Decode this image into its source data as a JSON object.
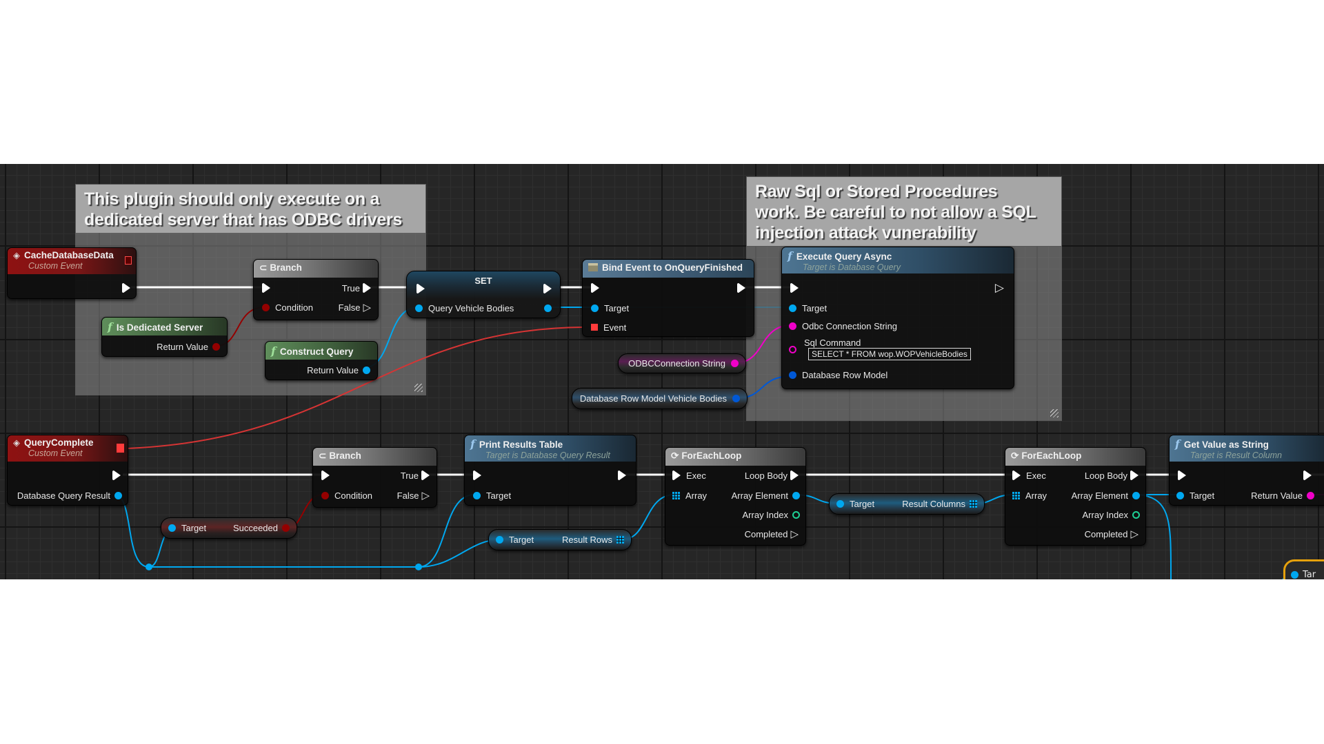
{
  "canvas": {
    "type": "blueprint-graph"
  },
  "colors": {
    "exec": "#ffffff",
    "object_pin": "#00a8f0",
    "string_pin": "#f000c8",
    "bool_pin": "#940000",
    "int_pin": "#1ed195",
    "struct_pin": "#0058d6",
    "delegate_pin": "#ff3b3b",
    "event_header": "#8e1212",
    "function_header": "#4e7592",
    "pure_header": "#5f8e5b"
  },
  "comments": [
    {
      "id": "comment-1",
      "text": "This plugin should only execute on a dedicated server that has ODBC drivers"
    },
    {
      "id": "comment-2",
      "text": "Raw Sql or Stored Procedures work. Be careful to not allow a SQL injection attack vunerability"
    }
  ],
  "nodes": {
    "cache_database_data": {
      "title": "CacheDatabaseData",
      "subtitle": "Custom Event",
      "icon": "event-diamond-icon"
    },
    "branch_1": {
      "title": "Branch",
      "icon": "branch-icon",
      "pins": {
        "condition": "Condition",
        "true": "True",
        "false": "False"
      }
    },
    "is_dedicated_server": {
      "title": "Is Dedicated Server",
      "icon": "function-icon",
      "pins": {
        "return": "Return Value"
      }
    },
    "construct_query": {
      "title": "Construct Query",
      "icon": "function-icon",
      "pins": {
        "return": "Return Value"
      }
    },
    "set_node": {
      "title": "SET",
      "pins": {
        "query_vehicle_bodies": "Query Vehicle Bodies"
      }
    },
    "bind_event": {
      "title": "Bind Event to OnQueryFinished",
      "icon": "delegate-icon",
      "pins": {
        "target": "Target",
        "event": "Event"
      }
    },
    "odbc_connection_var": {
      "label": "ODBCConnection String"
    },
    "db_row_model_var": {
      "label": "Database Row Model Vehicle Bodies"
    },
    "execute_query_async": {
      "title": "Execute Query Async",
      "subtitle": "Target is Database Query",
      "icon": "function-icon",
      "pins": {
        "target": "Target",
        "odbc_connection_string": "Odbc Connection String",
        "sql_command": "Sql Command",
        "sql_command_value": "SELECT * FROM wop.WOPVehicleBodies",
        "database_row_model": "Database Row Model"
      }
    },
    "query_complete": {
      "title": "QueryComplete",
      "subtitle": "Custom Event",
      "icon": "event-diamond-icon",
      "pins": {
        "result": "Database Query Result"
      }
    },
    "branch_2": {
      "title": "Branch",
      "icon": "branch-icon",
      "pins": {
        "condition": "Condition",
        "true": "True",
        "false": "False"
      }
    },
    "succeeded_get": {
      "target": "Target",
      "output": "Succeeded"
    },
    "print_results_table": {
      "title": "Print Results Table",
      "subtitle": "Target is Database Query Result",
      "icon": "function-icon",
      "pins": {
        "target": "Target"
      }
    },
    "result_rows_get": {
      "target": "Target",
      "output": "Result Rows"
    },
    "foreach_1": {
      "title": "ForEachLoop",
      "icon": "loop-icon",
      "pins": {
        "exec": "Exec",
        "array": "Array",
        "loop_body": "Loop Body",
        "array_element": "Array Element",
        "array_index": "Array Index",
        "completed": "Completed"
      }
    },
    "result_columns_get": {
      "target": "Target",
      "output": "Result Columns"
    },
    "foreach_2": {
      "title": "ForEachLoop",
      "icon": "loop-icon",
      "pins": {
        "exec": "Exec",
        "array": "Array",
        "loop_body": "Loop Body",
        "array_element": "Array Element",
        "array_index": "Array Index",
        "completed": "Completed"
      }
    },
    "get_value_as_string": {
      "title": "Get Value as String",
      "subtitle": "Target is Result Column",
      "icon": "function-icon",
      "pins": {
        "target": "Target",
        "return": "Return Value"
      }
    },
    "partial_node": {
      "target": "Tar"
    }
  }
}
